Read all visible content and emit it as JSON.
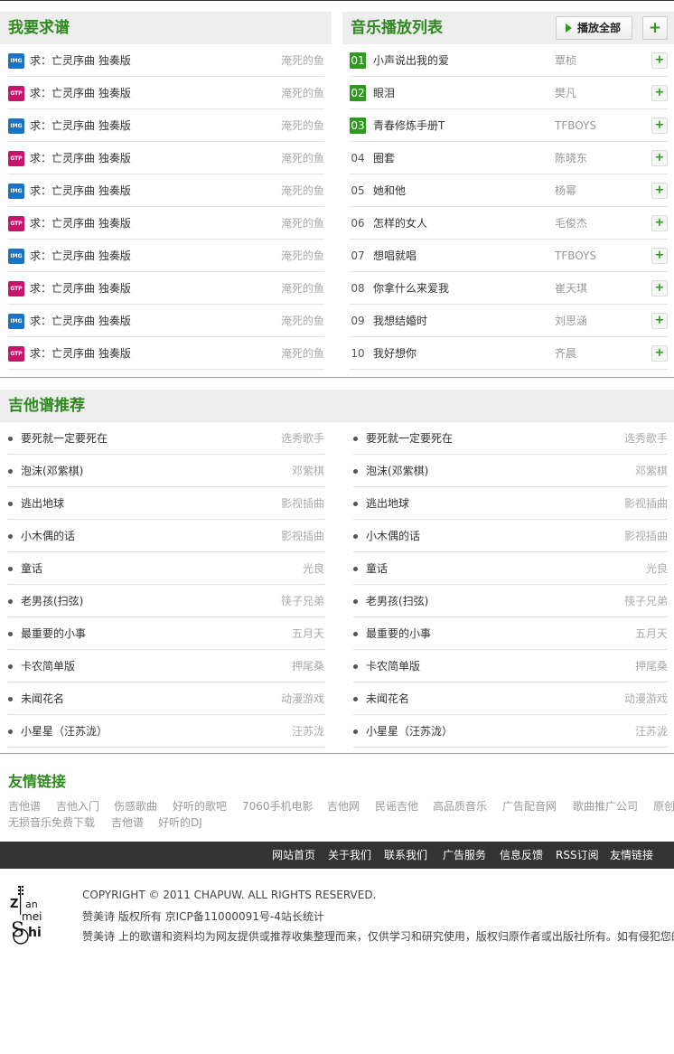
{
  "requests": {
    "title": "我要求谱",
    "items": [
      {
        "badge": "IMG",
        "type": "img",
        "title": "求：亡灵序曲 独奏版",
        "user": "淹死的鱼"
      },
      {
        "badge": "GTP",
        "type": "gtp",
        "title": "求：亡灵序曲 独奏版",
        "user": "淹死的鱼"
      },
      {
        "badge": "IMG",
        "type": "img",
        "title": "求：亡灵序曲 独奏版",
        "user": "淹死的鱼"
      },
      {
        "badge": "GTP",
        "type": "gtp",
        "title": "求：亡灵序曲 独奏版",
        "user": "淹死的鱼"
      },
      {
        "badge": "IMG",
        "type": "img",
        "title": "求：亡灵序曲 独奏版",
        "user": "淹死的鱼"
      },
      {
        "badge": "GTP",
        "type": "gtp",
        "title": "求：亡灵序曲 独奏版",
        "user": "淹死的鱼"
      },
      {
        "badge": "IMG",
        "type": "img",
        "title": "求：亡灵序曲 独奏版",
        "user": "淹死的鱼"
      },
      {
        "badge": "GTP",
        "type": "gtp",
        "title": "求：亡灵序曲 独奏版",
        "user": "淹死的鱼"
      },
      {
        "badge": "IMG",
        "type": "img",
        "title": "求：亡灵序曲 独奏版",
        "user": "淹死的鱼"
      },
      {
        "badge": "GTP",
        "type": "gtp",
        "title": "求：亡灵序曲 独奏版",
        "user": "淹死的鱼"
      }
    ]
  },
  "playlist": {
    "title": "音乐播放列表",
    "play_all_label": "播放全部",
    "add_all_label": "+",
    "add_label": "+",
    "songs": [
      {
        "num": "01",
        "title": "小声说出我的爱",
        "artist": "覃桢"
      },
      {
        "num": "02",
        "title": "眼泪",
        "artist": "樊凡"
      },
      {
        "num": "03",
        "title": "青春修炼手册T",
        "artist": "TFBOYS"
      },
      {
        "num": "04",
        "title": "圈套",
        "artist": "陈晓东"
      },
      {
        "num": "05",
        "title": "她和他",
        "artist": "杨幂"
      },
      {
        "num": "06",
        "title": "怎样的女人",
        "artist": "毛俊杰"
      },
      {
        "num": "07",
        "title": "想唱就唱",
        "artist": "TFBOYS"
      },
      {
        "num": "08",
        "title": "你拿什么来爱我",
        "artist": "崔天琪"
      },
      {
        "num": "09",
        "title": "我想结婚时",
        "artist": "刘思涵"
      },
      {
        "num": "10",
        "title": "我好想你",
        "artist": "齐晨"
      }
    ]
  },
  "recommend": {
    "title": "吉他谱推荐",
    "left": [
      {
        "title": "要死就一定要死在",
        "category": "选秀歌手"
      },
      {
        "title": "泡沫(邓紫棋)",
        "category": "邓紫棋"
      },
      {
        "title": "逃出地球",
        "category": "影视插曲"
      },
      {
        "title": "小木偶的话",
        "category": "影视插曲"
      },
      {
        "title": "童话",
        "category": "光良"
      },
      {
        "title": "老男孩(扫弦)",
        "category": "筷子兄弟"
      },
      {
        "title": "最重要的小事",
        "category": "五月天"
      },
      {
        "title": "卡农简单版",
        "category": "押尾桑"
      },
      {
        "title": "未闻花名",
        "category": "动漫游戏"
      },
      {
        "title": "小星星（汪苏泷）",
        "category": "汪苏泷"
      }
    ],
    "right": [
      {
        "title": "要死就一定要死在",
        "category": "选秀歌手"
      },
      {
        "title": "泡沫(邓紫棋)",
        "category": "邓紫棋"
      },
      {
        "title": "逃出地球",
        "category": "影视插曲"
      },
      {
        "title": "小木偶的话",
        "category": "影视插曲"
      },
      {
        "title": "童话",
        "category": "光良"
      },
      {
        "title": "老男孩(扫弦)",
        "category": "筷子兄弟"
      },
      {
        "title": "最重要的小事",
        "category": "五月天"
      },
      {
        "title": "卡农简单版",
        "category": "押尾桑"
      },
      {
        "title": "未闻花名",
        "category": "动漫游戏"
      },
      {
        "title": "小星星（汪苏泷）",
        "category": "汪苏泷"
      }
    ]
  },
  "friend_links": {
    "title": "友情链接",
    "row1": [
      "吉他谱",
      "吉他入门",
      "伤感歌曲",
      "好听的歌吧",
      "7060手机电影",
      "吉他网",
      "民谣吉他",
      "高品质音乐",
      "广告配音网",
      "歌曲推广公司",
      "原创"
    ],
    "row2": [
      "无损音乐免费下载",
      "吉他谱",
      "好听的DJ"
    ]
  },
  "footer_nav": [
    "网站首页",
    "关于我们",
    "联系我们",
    "广告服务",
    "信息反馈",
    "RSS订阅",
    "友情链接"
  ],
  "footer": {
    "logo_text": "Zan mei Shi",
    "copyright": "COPYRIGHT © 2011 CHAPUW. ALL RIGHTS RESERVED.",
    "icp": "赞美诗  版权所有 京ICP备11000091号-4站长统计",
    "disclaimer": "赞美诗 上的歌谱和资料均为网友提供或推荐收集整理而来，仅供学习和研究使用，版权归原作者或出版社所有。如有侵犯您的"
  },
  "colors": {
    "heading_green": "#2e8a1e",
    "accent_green": "#2e9a1e",
    "img_badge": "#1a73c6",
    "gtp_badge": "#c8156b",
    "footer_bar": "#333333"
  }
}
